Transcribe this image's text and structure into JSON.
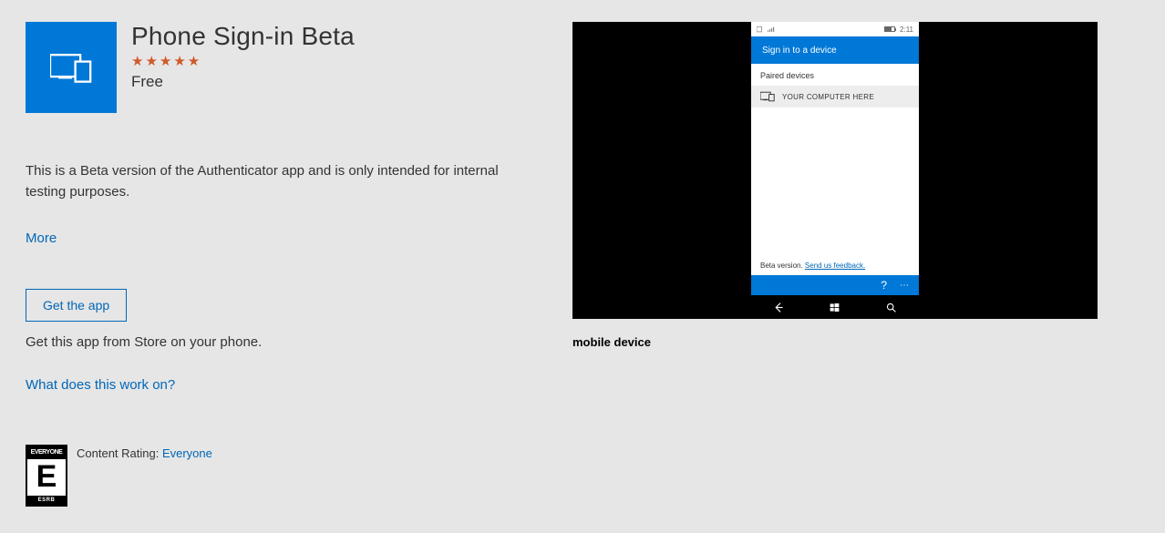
{
  "app": {
    "title": "Phone Sign-in Beta",
    "rating_stars": "★★★★★",
    "price": "Free",
    "description": "This is a Beta version of the Authenticator app and is only intended for internal testing purposes.",
    "more_label": "More",
    "get_button_label": "Get the app",
    "sub_note": "Get this app from Store on your phone.",
    "works_link": "What does this work on?",
    "content_rating_label": "Content Rating: ",
    "content_rating_value": "Everyone",
    "esrb_top": "EVERYONE",
    "esrb_letter": "E",
    "esrb_bottom": "ESRB"
  },
  "screenshot": {
    "caption": "mobile device",
    "status_time": "2:11",
    "app_bar_title": "Sign in to a device",
    "section_label": "Paired devices",
    "device_name": "YOUR COMPUTER HERE",
    "beta_text": "Beta version. ",
    "feedback_link": "Send us feedback.",
    "help_icon": "?",
    "more_icon": "⋯"
  }
}
